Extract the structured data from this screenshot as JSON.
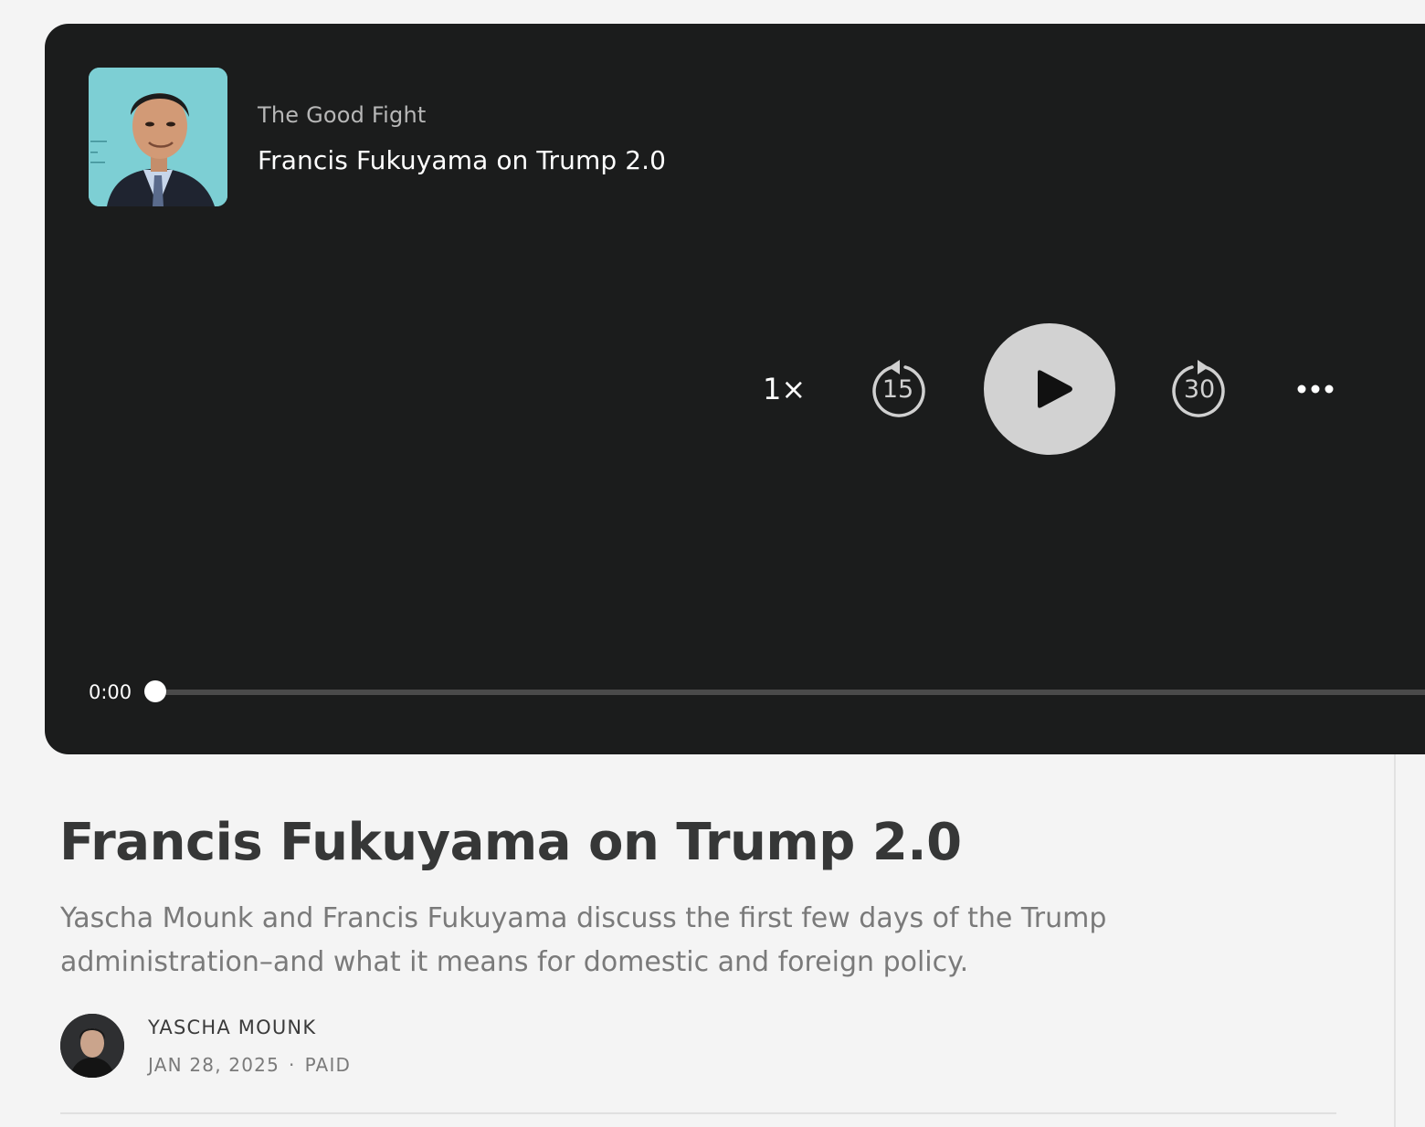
{
  "player": {
    "show_name": "The Good Fight",
    "episode_title": "Francis Fukuyama on Trump 2.0",
    "speed_label": "1×",
    "skip_back_seconds": "15",
    "skip_forward_seconds": "30",
    "current_time": "0:00",
    "progress": 0,
    "icons": {
      "play": "play-icon",
      "skip_back": "skip-back-icon",
      "skip_forward": "skip-forward-icon",
      "more": "more-icon"
    },
    "colors": {
      "background": "#1b1c1c",
      "play_button": "#d2d2d2",
      "track": "#4a4a4a"
    }
  },
  "post": {
    "title": "Francis Fukuyama on Trump 2.0",
    "subtitle": "Yascha Mounk and Francis Fukuyama discuss the first few days of the Trump administration–and what it means for domestic and foreign policy.",
    "author": "YASCHA MOUNK",
    "date": "JAN 28, 2025",
    "separator": "·",
    "access": "PAID"
  }
}
